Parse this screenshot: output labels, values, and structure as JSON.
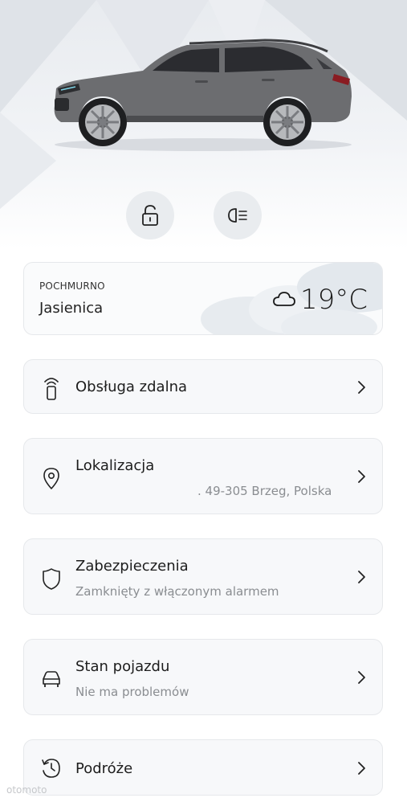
{
  "weather": {
    "condition": "POCHMURNO",
    "location": "Jasienica",
    "temperature": "19°C",
    "icon": "cloud-icon"
  },
  "quick_actions": [
    {
      "icon": "unlock-icon"
    },
    {
      "icon": "headlights-icon"
    }
  ],
  "menu": [
    {
      "title": "Obsługa zdalna",
      "subtitle": "",
      "icon": "remote-key-icon"
    },
    {
      "title": "Lokalizacja",
      "subtitle": ". 49-305 Brzeg, Polska",
      "icon": "location-pin-icon"
    },
    {
      "title": "Zabezpieczenia",
      "subtitle": "Zamknięty z włączonym alarmem",
      "icon": "shield-icon"
    },
    {
      "title": "Stan pojazdu",
      "subtitle": "Nie ma problemów",
      "icon": "car-icon"
    },
    {
      "title": "Podróże",
      "subtitle": "",
      "icon": "history-icon"
    }
  ],
  "watermark": "otomoto"
}
